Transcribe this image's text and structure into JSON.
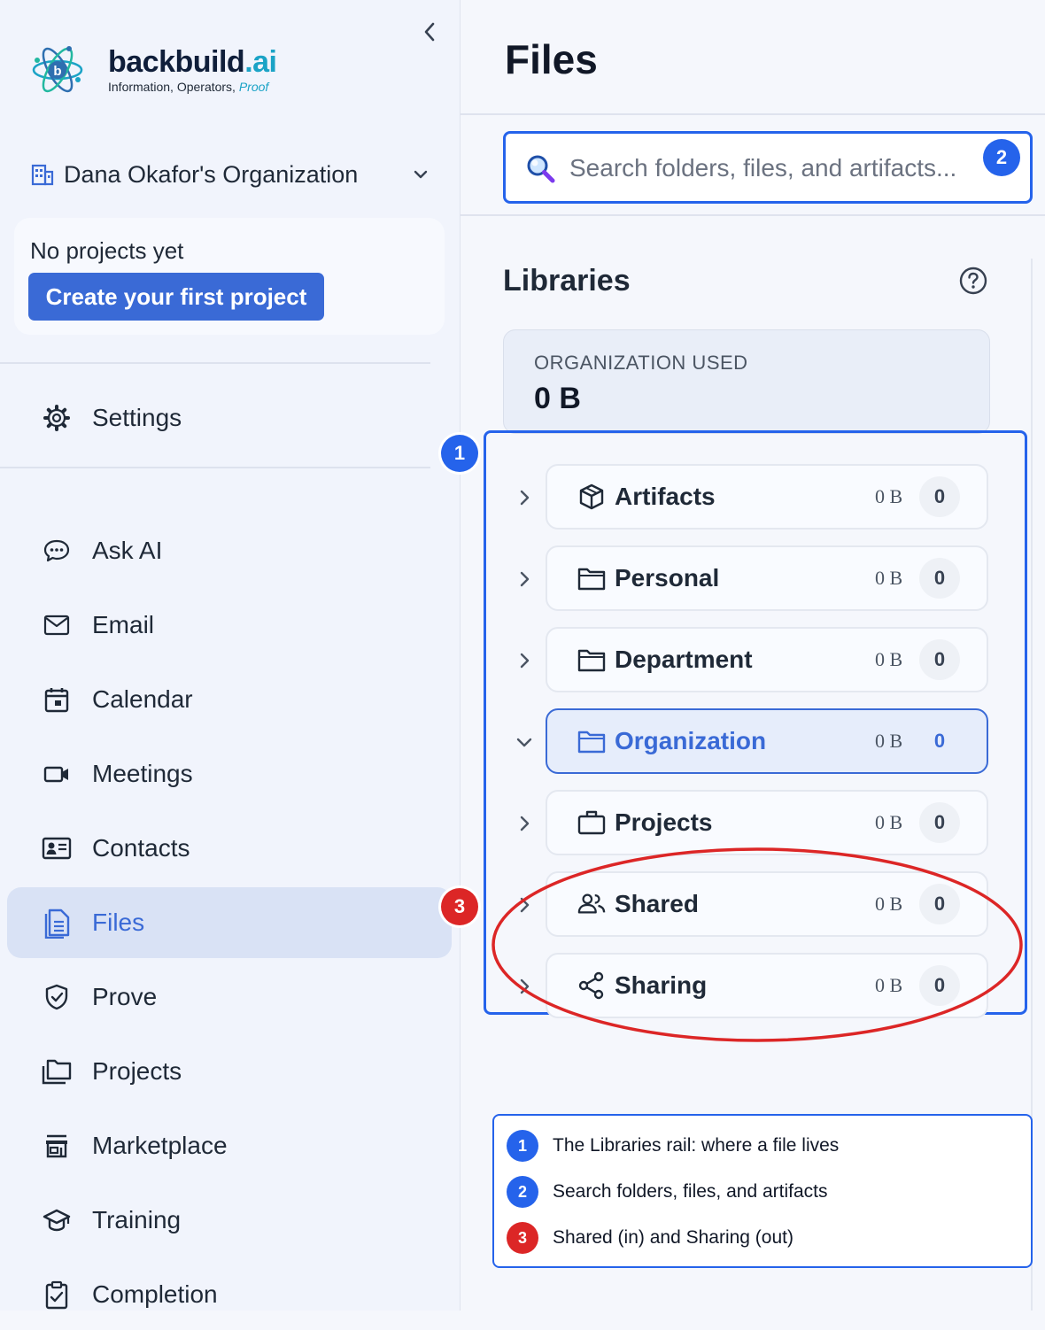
{
  "brand": {
    "name_main": "backbuild",
    "name_ext": ".ai",
    "tagline": "Information, Operators, ",
    "tagline_em": "Proof"
  },
  "org": {
    "name": "Dana Okafor's Organization"
  },
  "projects_card": {
    "empty_text": "No projects yet",
    "create_label": "Create your first project"
  },
  "settings_label": "Settings",
  "nav": {
    "ask_ai": "Ask AI",
    "email": "Email",
    "calendar": "Calendar",
    "meetings": "Meetings",
    "contacts": "Contacts",
    "files": "Files",
    "prove": "Prove",
    "projects": "Projects",
    "marketplace": "Marketplace",
    "training": "Training",
    "completion": "Completion"
  },
  "page": {
    "title": "Files"
  },
  "search": {
    "placeholder": "Search folders, files, and artifacts..."
  },
  "libraries": {
    "title": "Libraries",
    "used_label": "ORGANIZATION USED",
    "used_value": "0 B",
    "rows": [
      {
        "name": "Artifacts",
        "size": "0 B",
        "count": "0",
        "icon": "cube-icon"
      },
      {
        "name": "Personal",
        "size": "0 B",
        "count": "0",
        "icon": "folder-icon"
      },
      {
        "name": "Department",
        "size": "0 B",
        "count": "0",
        "icon": "folder-icon"
      },
      {
        "name": "Organization",
        "size": "0 B",
        "count": "0",
        "icon": "folder-icon",
        "selected": true
      },
      {
        "name": "Projects",
        "size": "0 B",
        "count": "0",
        "icon": "briefcase-icon"
      },
      {
        "name": "Shared",
        "size": "0 B",
        "count": "0",
        "icon": "users-icon"
      },
      {
        "name": "Sharing",
        "size": "0 B",
        "count": "0",
        "icon": "share-icon"
      }
    ]
  },
  "annotations": {
    "markers": [
      "1",
      "2",
      "3"
    ],
    "legend": [
      {
        "num": "1",
        "text": "The Libraries rail: where a file lives"
      },
      {
        "num": "2",
        "text": "Search folders, files, and artifacts"
      },
      {
        "num": "3",
        "text": "Shared (in) and Sharing (out)"
      }
    ]
  },
  "colors": {
    "accent": "#3a6ad6",
    "annotation_blue": "#2563eb",
    "annotation_red": "#dc2626",
    "brand_teal": "#1ba3c6"
  }
}
